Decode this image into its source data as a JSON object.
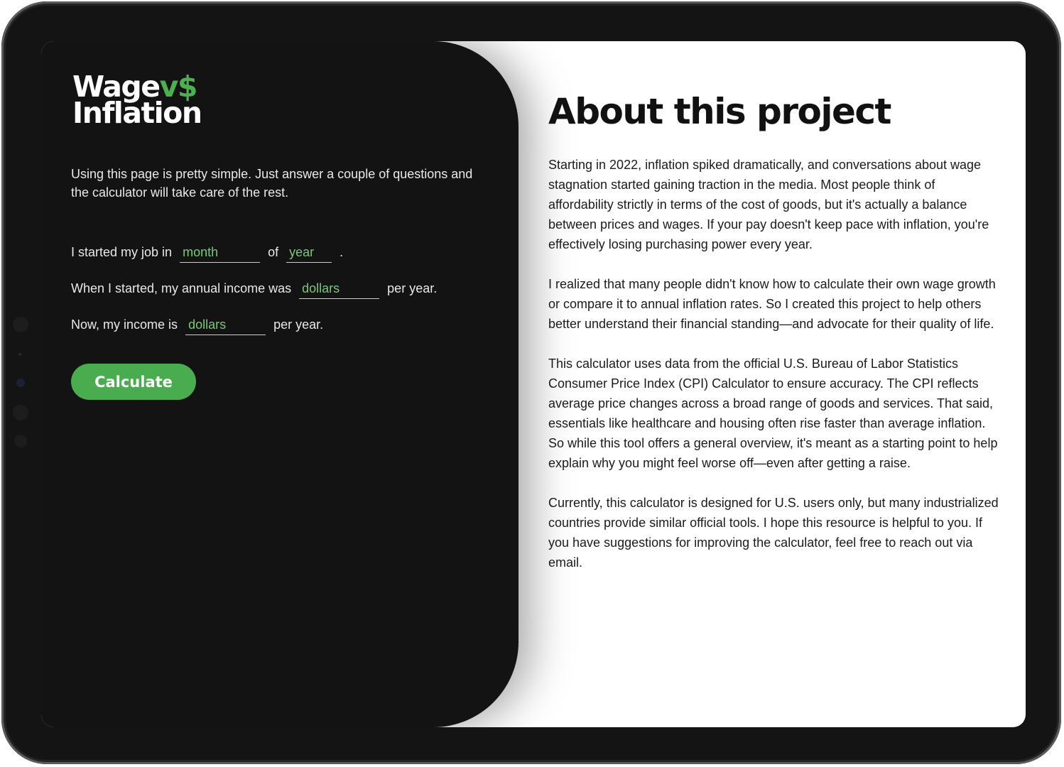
{
  "logo": {
    "line1": "Wage",
    "vs": "v$",
    "line2": "Inflation"
  },
  "intro": "Using this page is pretty simple. Just answer a couple of questions and the calculator will take care of the rest.",
  "form": {
    "line1": {
      "prefix": "I started my job in",
      "month_placeholder": "month",
      "middle": "of",
      "year_placeholder": "year",
      "suffix": "."
    },
    "line2": {
      "prefix": "When I started, my annual income was",
      "placeholder": "dollars",
      "suffix": "per year."
    },
    "line3": {
      "prefix": "Now, my income is",
      "placeholder": "dollars",
      "suffix": "per year."
    },
    "calculate_label": "Calculate"
  },
  "about": {
    "title": "About this project",
    "paragraphs": [
      "Starting in 2022, inflation spiked dramatically, and conversations about wage stagnation started gaining traction in the media. Most people think of affordability strictly in terms of the cost of goods, but it's actually a balance between prices and wages. If your pay doesn't keep pace with inflation, you're effectively losing purchasing power every year.",
      "I realized that many people didn't know how to calculate their own wage growth or compare it to annual inflation rates. So I created this project to help others better understand their financial standing—and advocate for their quality of life.",
      "This calculator uses data from the official U.S. Bureau of Labor Statistics Consumer Price Index (CPI) Calculator to ensure accuracy. The CPI reflects average price changes across a broad range of goods and services. That said, essentials like healthcare and housing often rise faster than average inflation. So while this tool offers a general overview, it's meant as a starting point to help explain why you might feel worse off—even after getting a raise.",
      "Currently, this calculator is designed for U.S. users only, but many industrialized countries provide similar official tools. I hope this resource is helpful to you. If you have suggestions for improving the calculator, feel free to reach out via email."
    ]
  },
  "colors": {
    "accent": "#49ac4e",
    "panel_bg": "#131313",
    "page_bg": "#ffffff"
  }
}
